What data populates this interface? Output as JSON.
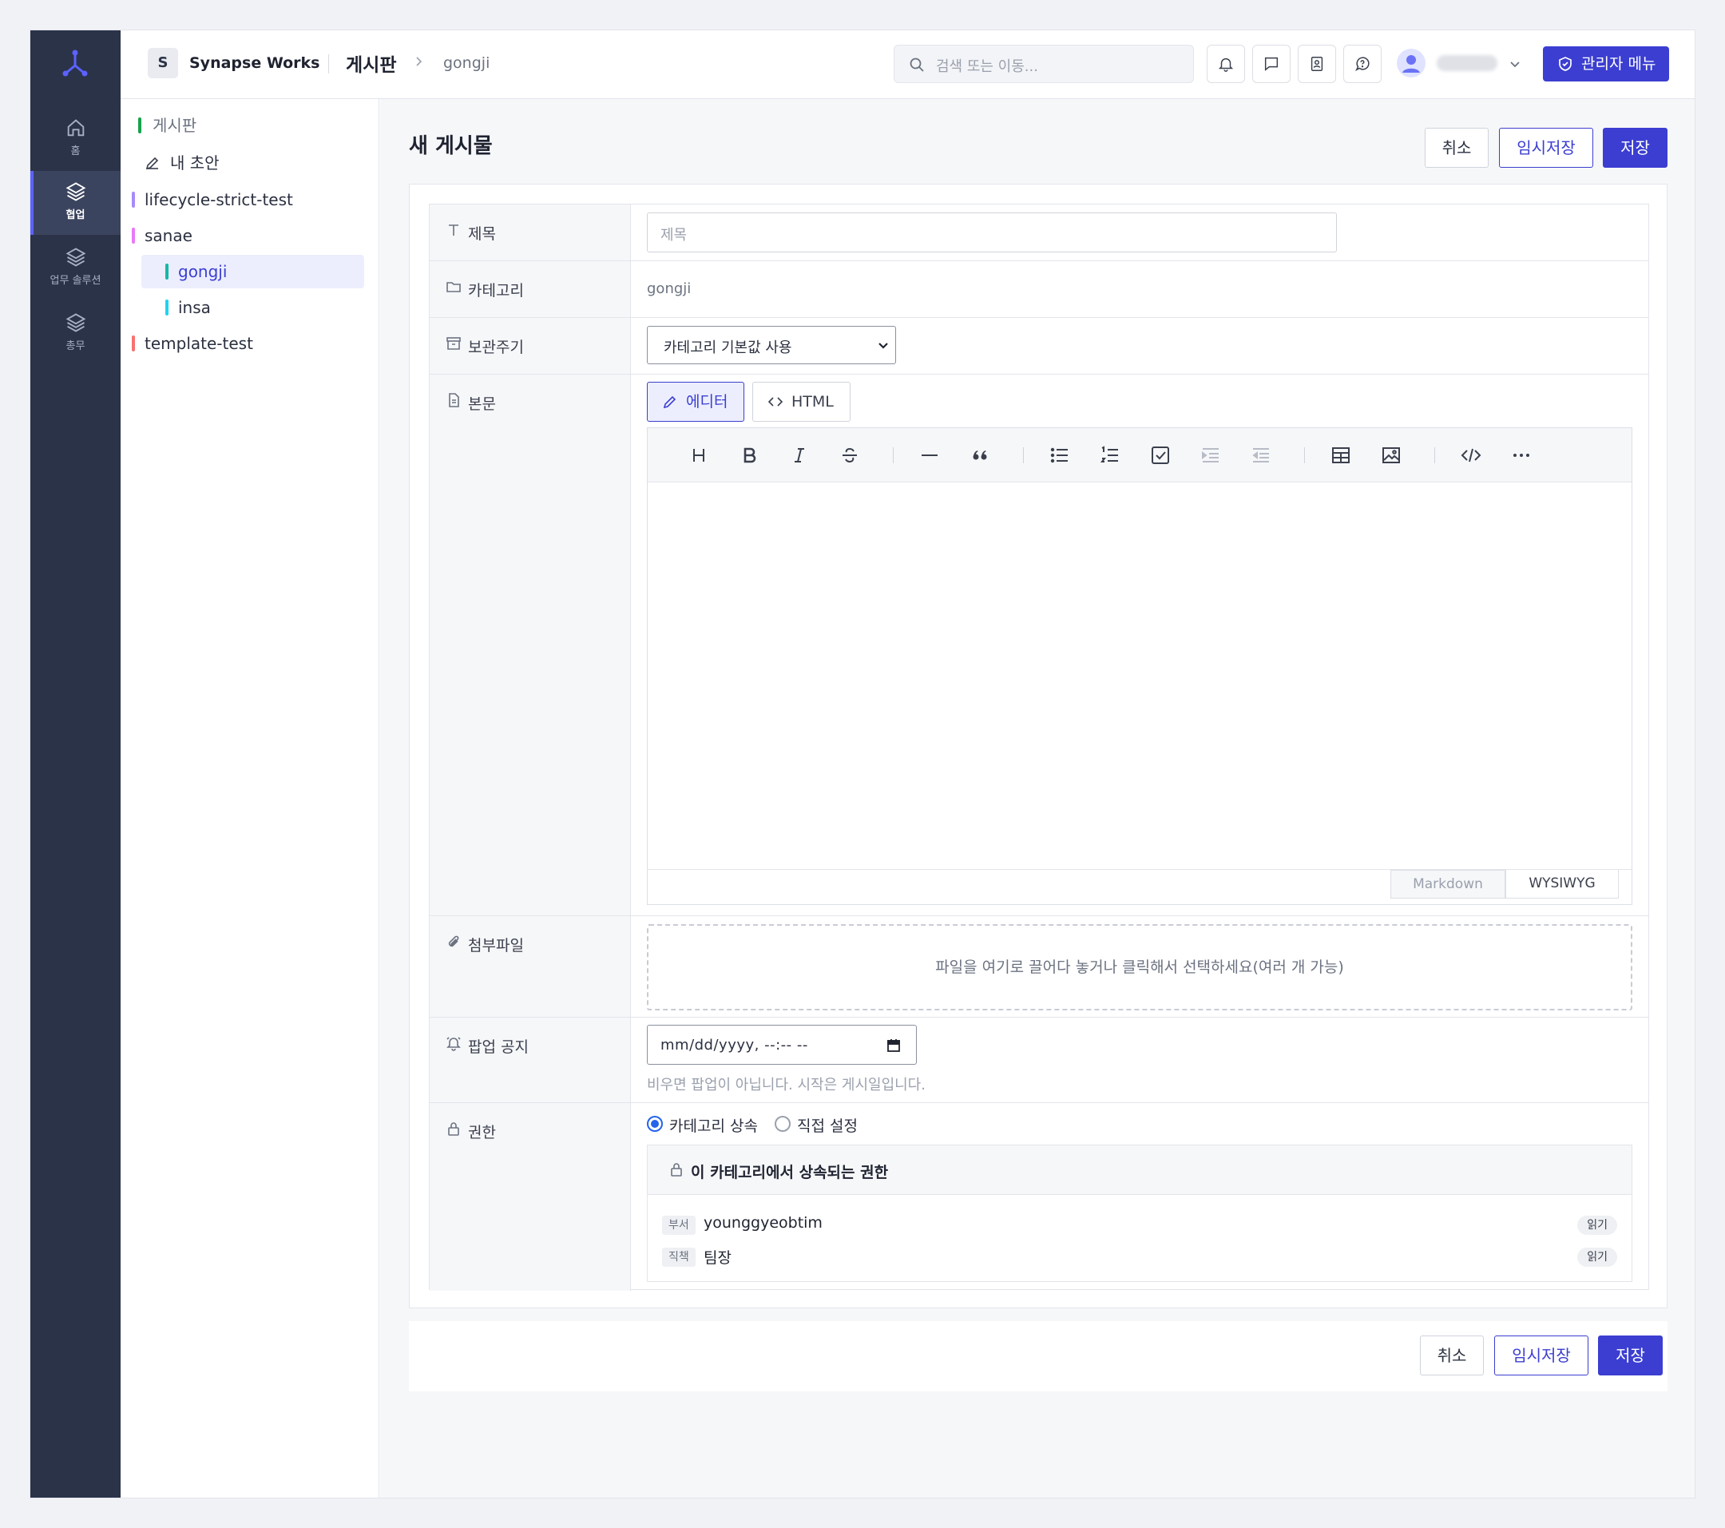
{
  "rail": {
    "items": [
      {
        "label": "홈",
        "icon": "home-icon"
      },
      {
        "label": "협업",
        "icon": "layers-icon",
        "active": true
      },
      {
        "label": "업무 솔루션",
        "icon": "layers-icon"
      },
      {
        "label": "총무",
        "icon": "layers-icon"
      }
    ]
  },
  "header": {
    "workspace_badge": "S",
    "workspace_name": "Synapse Works",
    "breadcrumb_main": "게시판",
    "breadcrumb_current": "gongji",
    "search_placeholder": "검색 또는 이동...",
    "admin_label": "관리자 메뉴"
  },
  "sidebar": {
    "items": [
      {
        "label": "게시판",
        "color": "#16a34a"
      },
      {
        "label": "내 초안",
        "icon": "pencil-icon"
      },
      {
        "label": "lifecycle-strict-test",
        "color": "#a78bfa"
      },
      {
        "label": "sanae",
        "color": "#e879f9"
      },
      {
        "label": "gongji",
        "color": "#14b8a6",
        "selected": true
      },
      {
        "label": "insa",
        "color": "#22d3ee"
      },
      {
        "label": "template-test",
        "color": "#f87171"
      }
    ]
  },
  "page": {
    "title": "새 게시물",
    "cancel_label": "취소",
    "draft_label": "임시저장",
    "save_label": "저장"
  },
  "form": {
    "title_label": "제목",
    "title_placeholder": "제목",
    "category_label": "카테고리",
    "category_value": "gongji",
    "retention_label": "보관주기",
    "retention_value": "카테고리 기본값 사용",
    "body_label": "본문",
    "tab_editor": "에디터",
    "tab_html": "HTML",
    "mode_markdown": "Markdown",
    "mode_wysiwyg": "WYSIWYG",
    "attach_label": "첨부파일",
    "attach_hint": "파일을 여기로 끌어다 놓거나 클릭해서 선택하세요(여러 개 가능)",
    "popup_label": "팝업 공지",
    "popup_value": "mm/dd/yyyy, --:-- --",
    "popup_hint": "비우면 팝업이 아닙니다. 시작은 게시일입니다.",
    "perm_label": "권한",
    "perm_inherit": "카테고리 상속",
    "perm_custom": "직접 설정",
    "perm_title": "이 카테고리에서 상속되는 권한",
    "perm_rows": [
      {
        "tag": "부서",
        "name": "younggyeobtim",
        "right": "읽기"
      },
      {
        "tag": "직책",
        "name": "팀장",
        "right": "읽기"
      }
    ]
  },
  "colors": {
    "accent": "#3b3ed1",
    "rail": "#2b3349"
  }
}
